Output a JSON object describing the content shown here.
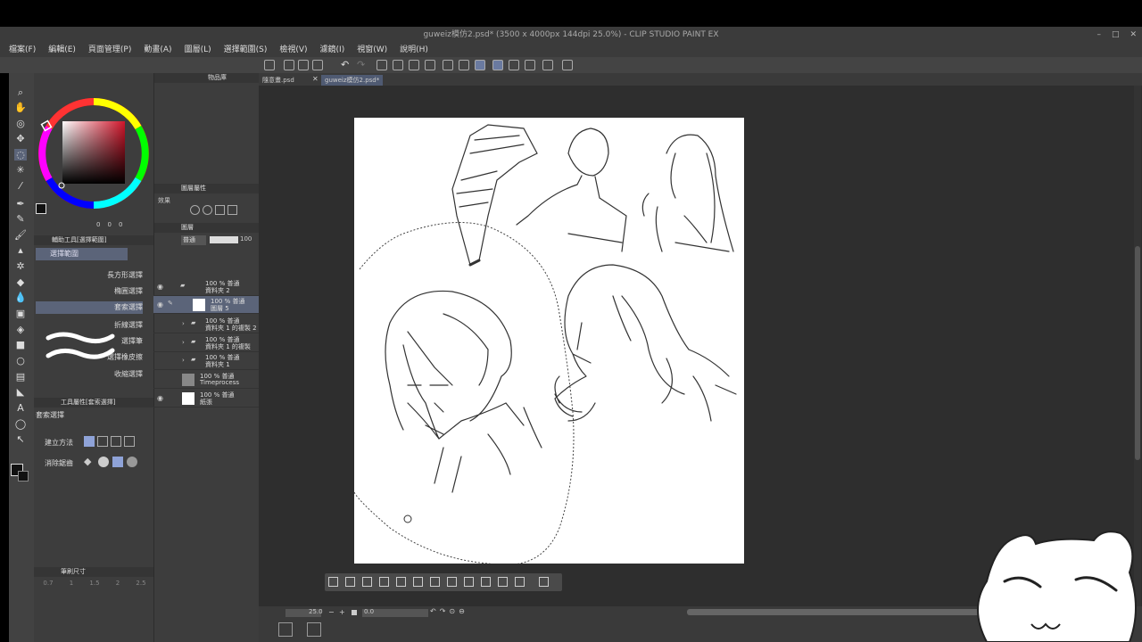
{
  "window": {
    "title": "guweiz模仿2.psd* (3500 x 4000px 144dpi 25.0%) - CLIP STUDIO PAINT EX",
    "controls": [
      "–",
      "□",
      "✕"
    ]
  },
  "menu": [
    "檔案(F)",
    "編輯(E)",
    "頁面管理(P)",
    "動畫(A)",
    "圖層(L)",
    "選擇範圍(S)",
    "檢視(V)",
    "濾鏡(I)",
    "視窗(W)",
    "說明(H)"
  ],
  "tabs": [
    {
      "label": "隨意畫.psd",
      "active": false
    },
    {
      "label": "guweiz模仿2.psd*",
      "active": true
    }
  ],
  "subtool_panel": {
    "header": "輔助工具[選擇範圍]",
    "group": "選擇範圍",
    "items": [
      "長方形選擇",
      "橢圓選擇",
      "套索選擇",
      "折線選擇",
      "選擇筆",
      "選擇橡皮擦",
      "收縮選擇"
    ],
    "selected": "套索選擇"
  },
  "tool_property": {
    "header": "工具屬性[套索選擇]",
    "name": "套索選擇",
    "create_method_label": "建立方法",
    "antialias_label": "消除鋸齒"
  },
  "brush_size": {
    "header": "筆刷尺寸",
    "values": [
      "0.7",
      "1",
      "1.5",
      "2",
      "2.5",
      "",
      "",
      "",
      "",
      "",
      "",
      "",
      "",
      "",
      ""
    ]
  },
  "color": {
    "main": "#111111",
    "sub": "#111111",
    "values": [
      "0",
      "0",
      "0"
    ]
  },
  "layer_property": {
    "header": "圖層屬性",
    "effect_label": "效果"
  },
  "layers": {
    "header": "圖層",
    "blend_mode": "普通",
    "opacity": "100",
    "items": [
      {
        "pct": "100 % 普通",
        "name": "資料夾 2",
        "type": "folder",
        "visible": true
      },
      {
        "pct": "100 % 普通",
        "name": "圖層 5",
        "type": "layer",
        "visible": true,
        "selected": true
      },
      {
        "pct": "100 % 普通",
        "name": "資料夾 1 的複製 2",
        "type": "folder",
        "visible": false
      },
      {
        "pct": "100 % 普通",
        "name": "資料夾 1 的複製",
        "type": "folder",
        "visible": false
      },
      {
        "pct": "100 % 普通",
        "name": "資料夾 1",
        "type": "folder",
        "visible": false
      },
      {
        "pct": "100 % 普通",
        "name": "Timeprocess",
        "type": "layer",
        "visible": false
      },
      {
        "pct": "100 % 普通",
        "name": "紙張",
        "type": "paper",
        "visible": true
      }
    ]
  },
  "statusbar": {
    "zoom": "25.0",
    "angle": "0.0"
  },
  "top_panel_tab": "物品庫"
}
